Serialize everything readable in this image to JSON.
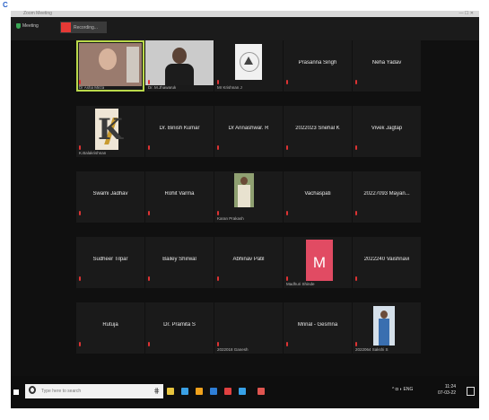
{
  "page": {
    "corner_mark": "C"
  },
  "window": {
    "title": "Zoom Meeting",
    "controls": "—  ☐  ✕"
  },
  "topbar": {
    "security_label": "Meeting",
    "recording_label": "Recording..."
  },
  "tiles": [
    {
      "name": "",
      "label": "Dr Asha Mirza",
      "type": "person",
      "active": true
    },
    {
      "name": "",
      "label": "Dr. M.Jhawaruk",
      "type": "dark"
    },
    {
      "name": "",
      "label": "Mr Krishnan J",
      "type": "logo"
    },
    {
      "name": "Prasanna Singh",
      "label": "",
      "type": "name"
    },
    {
      "name": "Neha Yadav",
      "label": "",
      "type": "name"
    },
    {
      "name": "",
      "label": "K.Balakrishnan",
      "type": "k"
    },
    {
      "name": "Dr. Binish Kumar",
      "label": "",
      "type": "name"
    },
    {
      "name": "Dr Annashwar. R",
      "label": "",
      "type": "name"
    },
    {
      "name": "2022023 Snehal K",
      "label": "",
      "type": "name"
    },
    {
      "name": "Vivek Jagtap",
      "label": "",
      "type": "name"
    },
    {
      "name": "Swami Jadhav",
      "label": "",
      "type": "name"
    },
    {
      "name": "Rohit Varma",
      "label": "",
      "type": "name"
    },
    {
      "name": "",
      "label": "Karan Prakash",
      "type": "boy"
    },
    {
      "name": "Vachaspati",
      "label": "",
      "type": "name"
    },
    {
      "name": "20227093 Mayan...",
      "label": "",
      "type": "name"
    },
    {
      "name": "Sudheer Tilpar",
      "label": "",
      "type": "name"
    },
    {
      "name": "Bailey Shirwal",
      "label": "",
      "type": "name"
    },
    {
      "name": "Abhinav Patil",
      "label": "",
      "type": "name"
    },
    {
      "name": "",
      "label": "Madhuri Shinde",
      "type": "m"
    },
    {
      "name": "2022240 Vaishnavi",
      "label": "",
      "type": "name"
    },
    {
      "name": "Rutuja",
      "label": "",
      "type": "name"
    },
    {
      "name": "Dr. Pramita S",
      "label": "",
      "type": "name"
    },
    {
      "name": "",
      "label": "2022018 Ganesh",
      "type": "empty"
    },
    {
      "name": "Mrinal - Gesmna",
      "label": "",
      "type": "name"
    },
    {
      "name": "",
      "label": "2022064 Sakshi S",
      "type": "girl"
    }
  ],
  "taskbar": {
    "search_placeholder": "Type here to search",
    "search_right": "⋕",
    "app_colors": [
      "#e7c43f",
      "#3aa0e4",
      "#f0a21c",
      "#2e7ed6",
      "#e04040",
      "#37a2e8",
      "#e05550"
    ],
    "tray_text": "^  ◘  ◗  ENG",
    "time": "11:24",
    "date": "07-03-22"
  }
}
